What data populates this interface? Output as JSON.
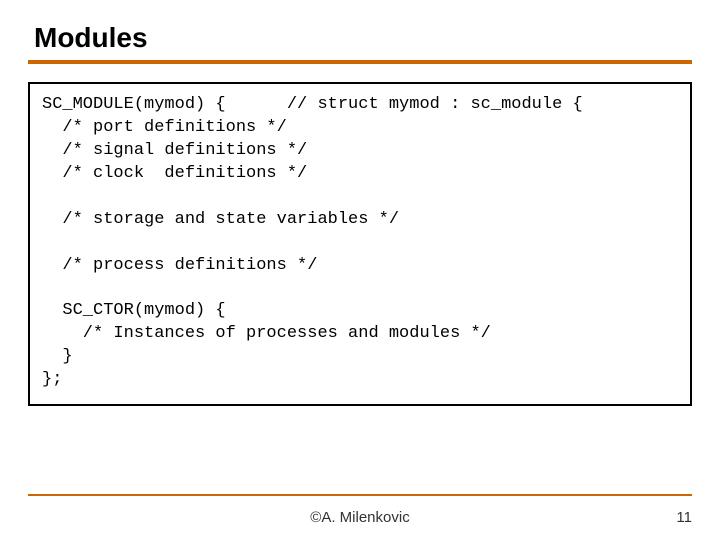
{
  "title": "Modules",
  "code": {
    "l1": "SC_MODULE(mymod) {      // struct mymod : sc_module {",
    "l2": "  /* port definitions */",
    "l3": "  /* signal definitions */",
    "l4": "  /* clock  definitions */",
    "l5": "",
    "l6": "  /* storage and state variables */",
    "l7": "",
    "l8": "  /* process definitions */",
    "l9": "",
    "l10": "  SC_CTOR(mymod) {",
    "l11": "    /* Instances of processes and modules */",
    "l12": "  }",
    "l13": "};"
  },
  "footer": {
    "author": "©A. Milenkovic",
    "page": "11"
  }
}
